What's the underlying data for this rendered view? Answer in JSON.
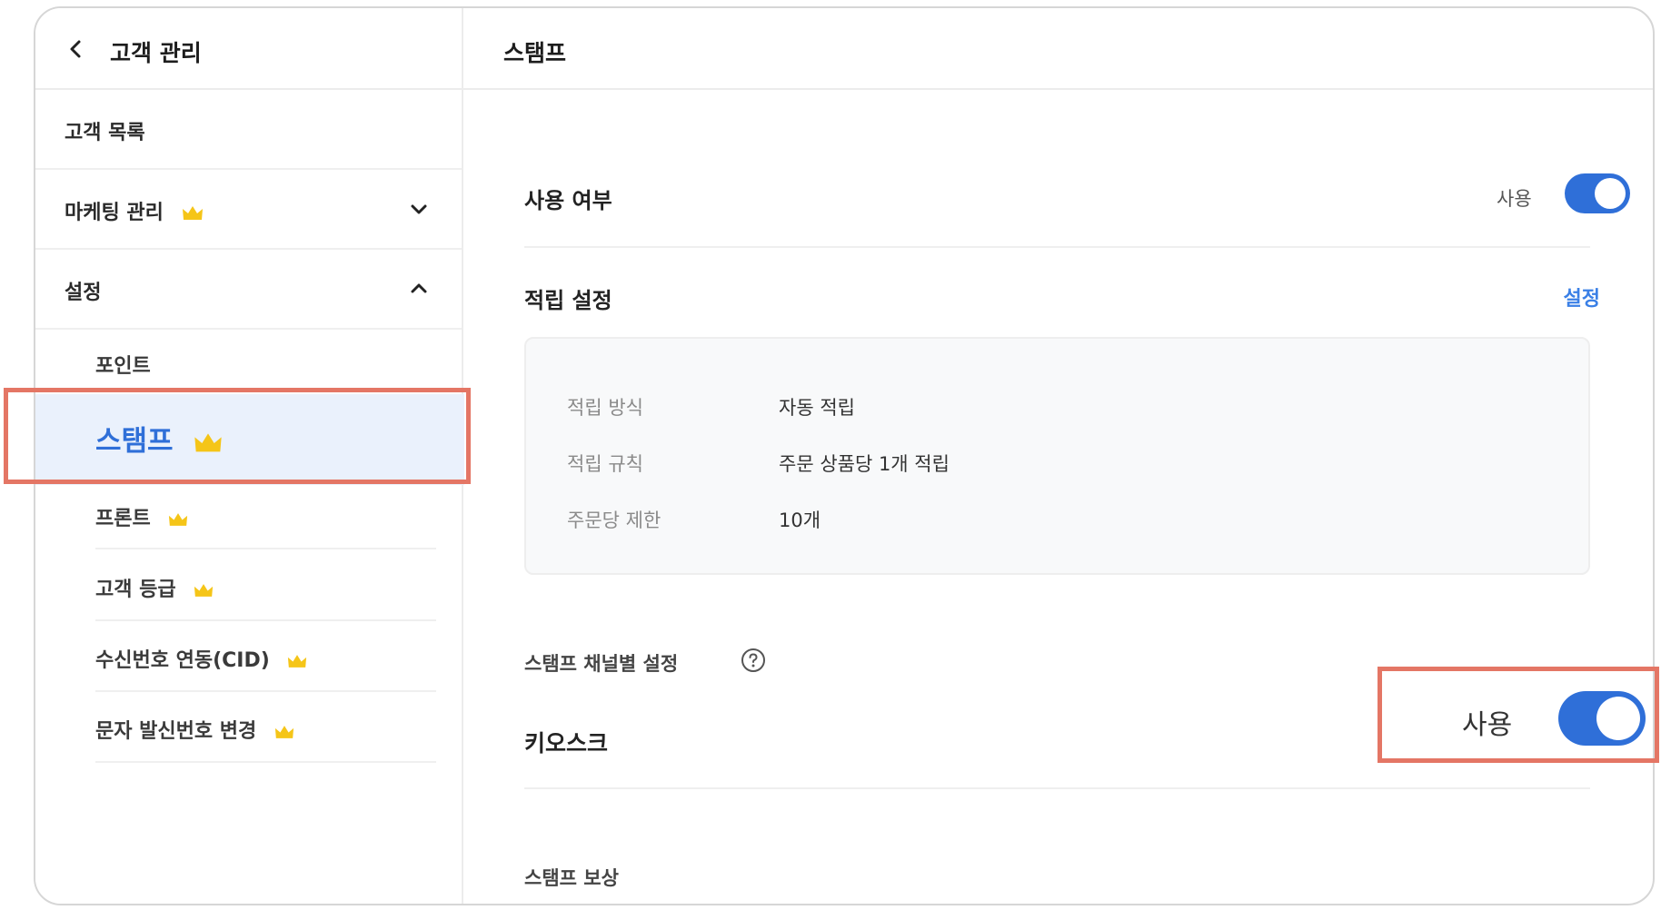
{
  "sidebar": {
    "header_title": "고객 관리",
    "items": [
      {
        "label": "고객 목록"
      },
      {
        "label": "마케팅 관리"
      },
      {
        "label": "설정"
      }
    ],
    "sub_items": [
      {
        "label": "포인트"
      },
      {
        "label": "스탬프"
      },
      {
        "label": "프론트"
      },
      {
        "label": "고객 등급"
      },
      {
        "label": "수신번호 연동(CID)"
      },
      {
        "label": "문자 발신번호 변경"
      }
    ]
  },
  "main": {
    "title": "스탬프",
    "usage": {
      "label": "사용 여부",
      "toggle_text": "사용",
      "on": true
    },
    "accrual": {
      "label": "적립 설정",
      "link": "설정",
      "rows": [
        {
          "key": "적립 방식",
          "value": "자동 적립"
        },
        {
          "key": "적립 규칙",
          "value": "주문 상품당 1개 적립"
        },
        {
          "key": "주문당 제한",
          "value": "10개"
        }
      ]
    },
    "channel": {
      "label": "스탬프 채널별 설정",
      "kiosk_label": "키오스크",
      "toggle_text": "사용",
      "on": true
    },
    "reward_label": "스탬프 보상"
  },
  "colors": {
    "accent": "#2f6fd8",
    "link": "#3b80e6",
    "crown": "#f5c518",
    "highlight": "#e47665"
  },
  "icons": [
    "back-icon",
    "chevron-down-icon",
    "chevron-up-icon",
    "crown-icon",
    "help-icon"
  ]
}
